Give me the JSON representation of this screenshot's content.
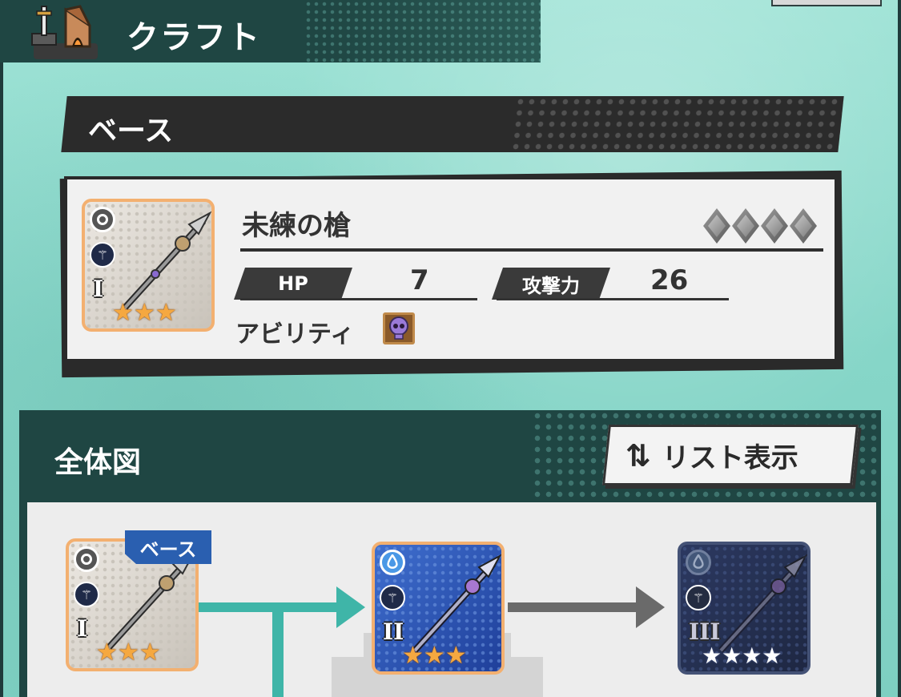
{
  "header": {
    "title": "クラフト",
    "icon": "forge-icon"
  },
  "base_section": {
    "title": "ベース"
  },
  "base_item": {
    "name": "未練の槍",
    "rank": "I",
    "stars": 3,
    "element_icon": "neutral-element-icon",
    "type_icon": "spear-type-icon",
    "rarity_gems": 4,
    "hp_label": "HP",
    "hp_value": "7",
    "atk_label": "攻撃力",
    "atk_value": "26",
    "ability_label": "アビリティ",
    "ability_icon": "skull-ability-icon"
  },
  "overview": {
    "title": "全体図",
    "list_button_label": "リスト表示",
    "list_button_icon": "swap-arrows-icon",
    "base_tag": "ベース",
    "nodes": [
      {
        "rank": "I",
        "stars": 3,
        "element": "neutral",
        "style": "base"
      },
      {
        "rank": "II",
        "stars": 3,
        "element": "water",
        "style": "crafted"
      },
      {
        "rank": "III",
        "stars": 4,
        "element": "water",
        "style": "locked"
      }
    ]
  },
  "colors": {
    "header_bg": "#1f4643",
    "accent_teal": "#3fb5a8",
    "tag_blue": "#2a5fb0",
    "star_gold": "#f5a840"
  }
}
